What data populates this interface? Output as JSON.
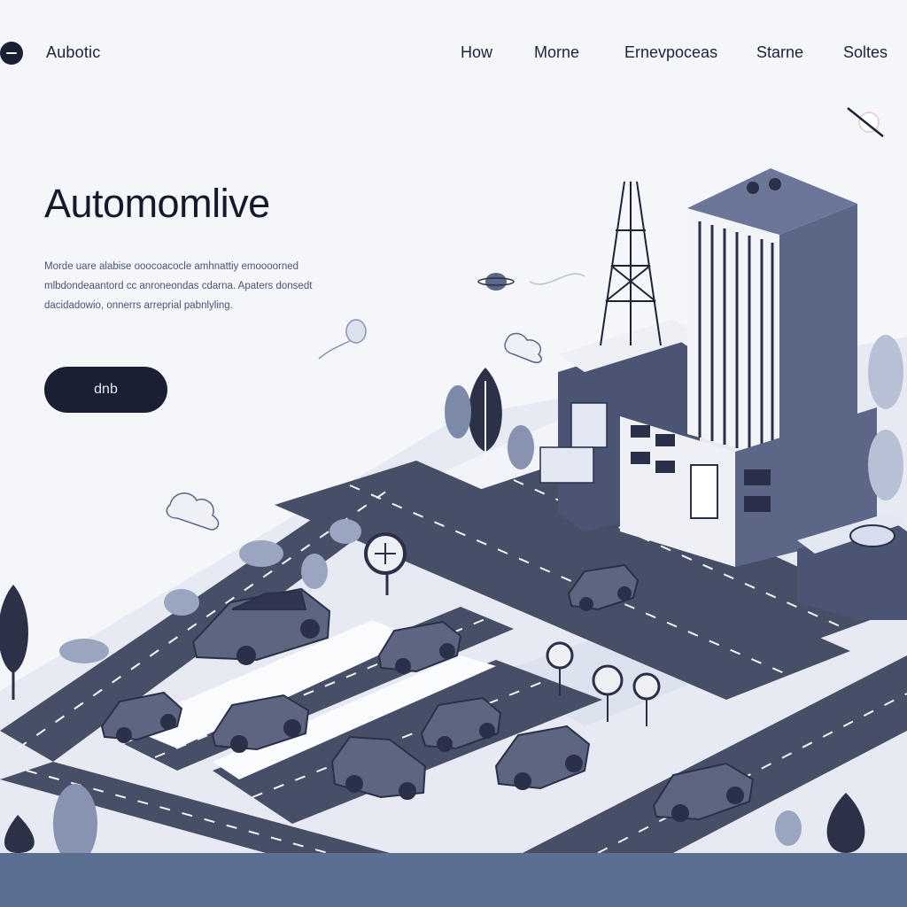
{
  "nav": {
    "brand": "Aubotic",
    "links": [
      "How",
      "Morne",
      "Ernevpoceas",
      "Starne",
      "Soltes"
    ]
  },
  "hero": {
    "title": "Automomlive",
    "description_lines": [
      "Morde uare alabise ooocoacocle amhnattiy emoooorned",
      "mlbdondeaantord cc anroneondas cdarna. Apaters donsedt",
      "dacidadowio, onnerrs arreprial pabnlyling."
    ],
    "cta_label": "dnb"
  },
  "colors": {
    "primary_dark": "#1a2033",
    "road": "#474f66",
    "building": "#5c6788",
    "accent_blue": "#c5cde4",
    "footer": "#5b6f92"
  },
  "icons": [
    "logo-dot-icon",
    "close-icon",
    "plus-sign-icon"
  ]
}
